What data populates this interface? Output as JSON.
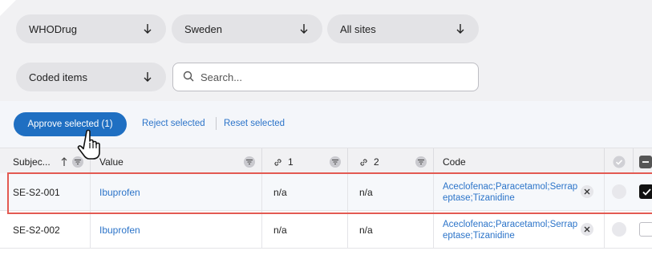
{
  "filters": {
    "dictionary": "WHODrug",
    "country": "Sweden",
    "site": "All sites",
    "item_filter": "Coded items"
  },
  "search": {
    "placeholder": "Search..."
  },
  "actions": {
    "approve": "Approve selected (1)",
    "reject": "Reject selected",
    "reset": "Reset selected"
  },
  "columns": {
    "subject": "Subjec...",
    "value": "Value",
    "level1": "1",
    "level2": "2",
    "code": "Code"
  },
  "rows": [
    {
      "subject": "SE-S2-001",
      "value": "Ibuprofen",
      "level1": "n/a",
      "level2": "n/a",
      "code": "Aceclofenac;Paracetamol;Serrapeptase;Tizanidine",
      "selected": true
    },
    {
      "subject": "SE-S2-002",
      "value": "Ibuprofen",
      "level1": "n/a",
      "level2": "n/a",
      "code": "Aceclofenac;Paracetamol;Serrapeptase;Tizanidine",
      "selected": false
    }
  ],
  "colors": {
    "primary": "#1f6fc2",
    "link": "#2c74c9",
    "highlight": "#e35a52"
  },
  "icons": [
    "arrow-down-icon",
    "search-icon",
    "sort-up-icon",
    "filter-icon",
    "link-icon",
    "remove-icon",
    "approved-status-icon",
    "select-all-checkbox",
    "hand-cursor"
  ]
}
